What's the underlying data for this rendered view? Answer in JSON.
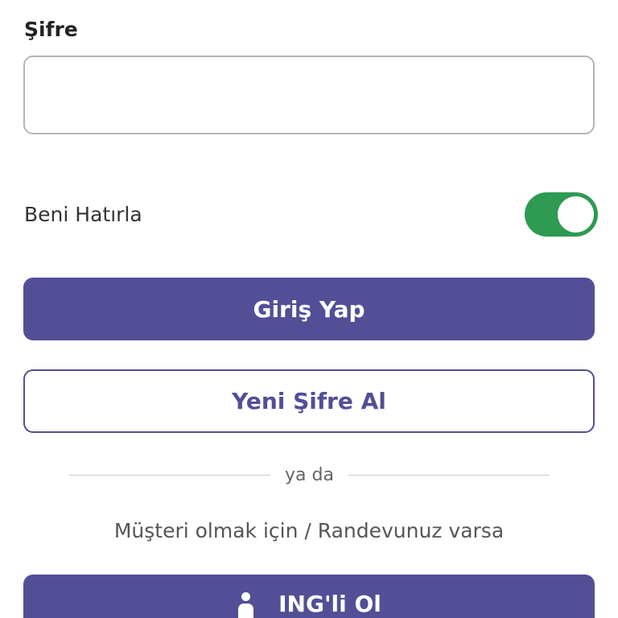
{
  "password": {
    "label": "Şifre",
    "value": "",
    "placeholder": ""
  },
  "remember_me": {
    "label": "Beni Hatırla",
    "enabled": true,
    "toggle_color": "#2e9a52"
  },
  "buttons": {
    "login_label": "Giriş Yap",
    "new_password_label": "Yeni Şifre Al",
    "join_label": "ING'li Ol"
  },
  "divider": {
    "text": "ya da"
  },
  "info": {
    "text": "Müşteri olmak için / Randevunuz varsa"
  },
  "icons": {
    "join_icon": "person-icon"
  },
  "colors": {
    "brand": "#524f96",
    "toggle_on": "#2e9a52",
    "input_border": "#b5b5b5"
  }
}
